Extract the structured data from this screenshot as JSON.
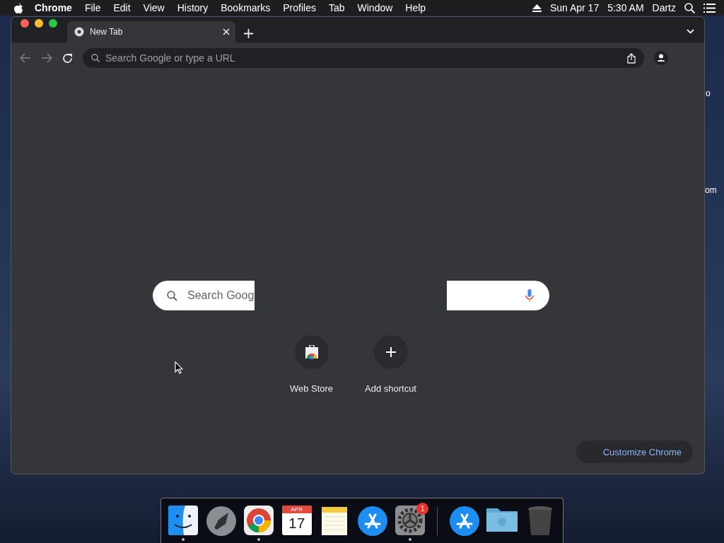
{
  "menu_bar": {
    "app": "Chrome",
    "items": [
      "File",
      "Edit",
      "View",
      "History",
      "Bookmarks",
      "Profiles",
      "Tab",
      "Window",
      "Help"
    ],
    "date": "Sun Apr 17",
    "time": "5:30 AM",
    "user": "Dartz"
  },
  "desktop_labels": [
    "o",
    "om"
  ],
  "browser": {
    "tabs": [
      {
        "title": "New Tab",
        "selected": true
      }
    ],
    "omnibox": {
      "placeholder": "Search Google or type a URL"
    },
    "search": {
      "placeholder": "Search Goog"
    },
    "shortcuts": [
      {
        "kind": "webstore",
        "label": "Web Store"
      },
      {
        "kind": "add",
        "label": "Add shortcut"
      }
    ],
    "customize_button": "Customize Chrome"
  },
  "dock": {
    "items": [
      {
        "kind": "finder",
        "running": true
      },
      {
        "kind": "launchpad",
        "running": false
      },
      {
        "kind": "chrome",
        "running": true
      },
      {
        "kind": "calendar",
        "month": "APR",
        "day": "17",
        "running": false
      },
      {
        "kind": "notes",
        "running": false
      },
      {
        "kind": "appstore",
        "running": false
      },
      {
        "kind": "settings",
        "badge": "1",
        "running": true
      },
      {
        "kind": "separator"
      },
      {
        "kind": "appstore",
        "running": false
      },
      {
        "kind": "folder",
        "running": false
      },
      {
        "kind": "trash",
        "running": false
      }
    ]
  }
}
